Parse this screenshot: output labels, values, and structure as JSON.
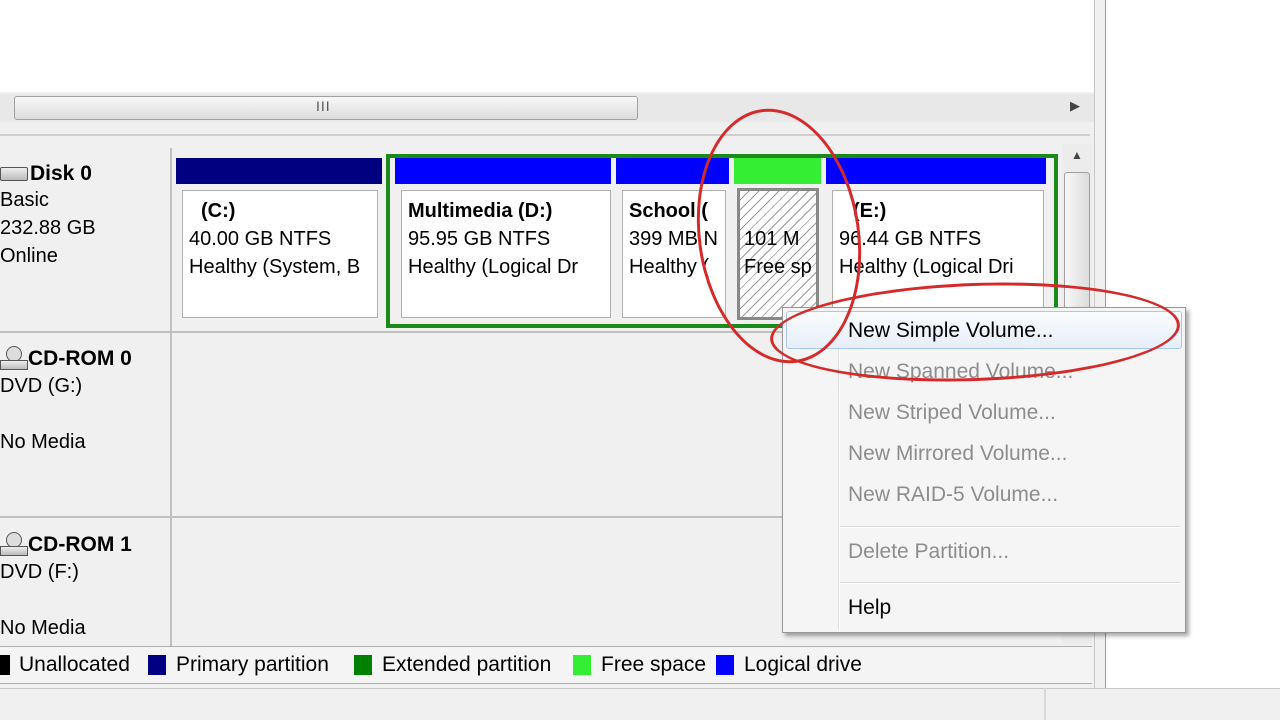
{
  "disks": [
    {
      "id": "disk0",
      "title": "Disk 0",
      "lines": [
        "Basic",
        "232.88 GB",
        "Online"
      ]
    },
    {
      "id": "cdrom0",
      "title": "CD-ROM 0",
      "lines": [
        "DVD (G:)",
        "",
        "No Media"
      ]
    },
    {
      "id": "cdrom1",
      "title": "CD-ROM 1",
      "lines": [
        "DVD (F:)",
        "",
        "No Media"
      ]
    }
  ],
  "partitions": [
    {
      "name": "(C:)",
      "size": "40.00 GB NTFS",
      "status": "Healthy (System, B",
      "type": "primary"
    },
    {
      "name": "Multimedia  (D:)",
      "size": "95.95 GB NTFS",
      "status": "Healthy (Logical Dr",
      "type": "logical"
    },
    {
      "name": "School  (",
      "size": "399 MB N",
      "status": "Healthy (",
      "type": "logical"
    },
    {
      "name": "",
      "size": "101 M",
      "status": "Free sp",
      "type": "free"
    },
    {
      "name": "(E:)",
      "size": "96.44 GB NTFS",
      "status": "Healthy (Logical Dri",
      "type": "logical"
    }
  ],
  "context_menu": {
    "items": [
      {
        "label": "New Simple Volume...",
        "enabled": true
      },
      {
        "label": "New Spanned Volume...",
        "enabled": false
      },
      {
        "label": "New Striped Volume...",
        "enabled": false
      },
      {
        "label": "New Mirrored Volume...",
        "enabled": false
      },
      {
        "label": "New RAID-5 Volume...",
        "enabled": false
      },
      {
        "label": "Delete Partition...",
        "enabled": false
      },
      {
        "label": "Help",
        "enabled": true
      }
    ]
  },
  "legend": [
    {
      "label": "Unallocated",
      "color": "#000000"
    },
    {
      "label": "Primary partition",
      "color": "#000080"
    },
    {
      "label": "Extended partition",
      "color": "#008000"
    },
    {
      "label": "Free space",
      "color": "#33ee33"
    },
    {
      "label": "Logical drive",
      "color": "#0000ff"
    }
  ],
  "scrollbar": {
    "grip": "III"
  },
  "colors": {
    "primary": "#000080",
    "logical": "#0000ff",
    "extended_border": "#1a8a1a",
    "free": "#33ee33",
    "annotation": "#d42a2a"
  }
}
